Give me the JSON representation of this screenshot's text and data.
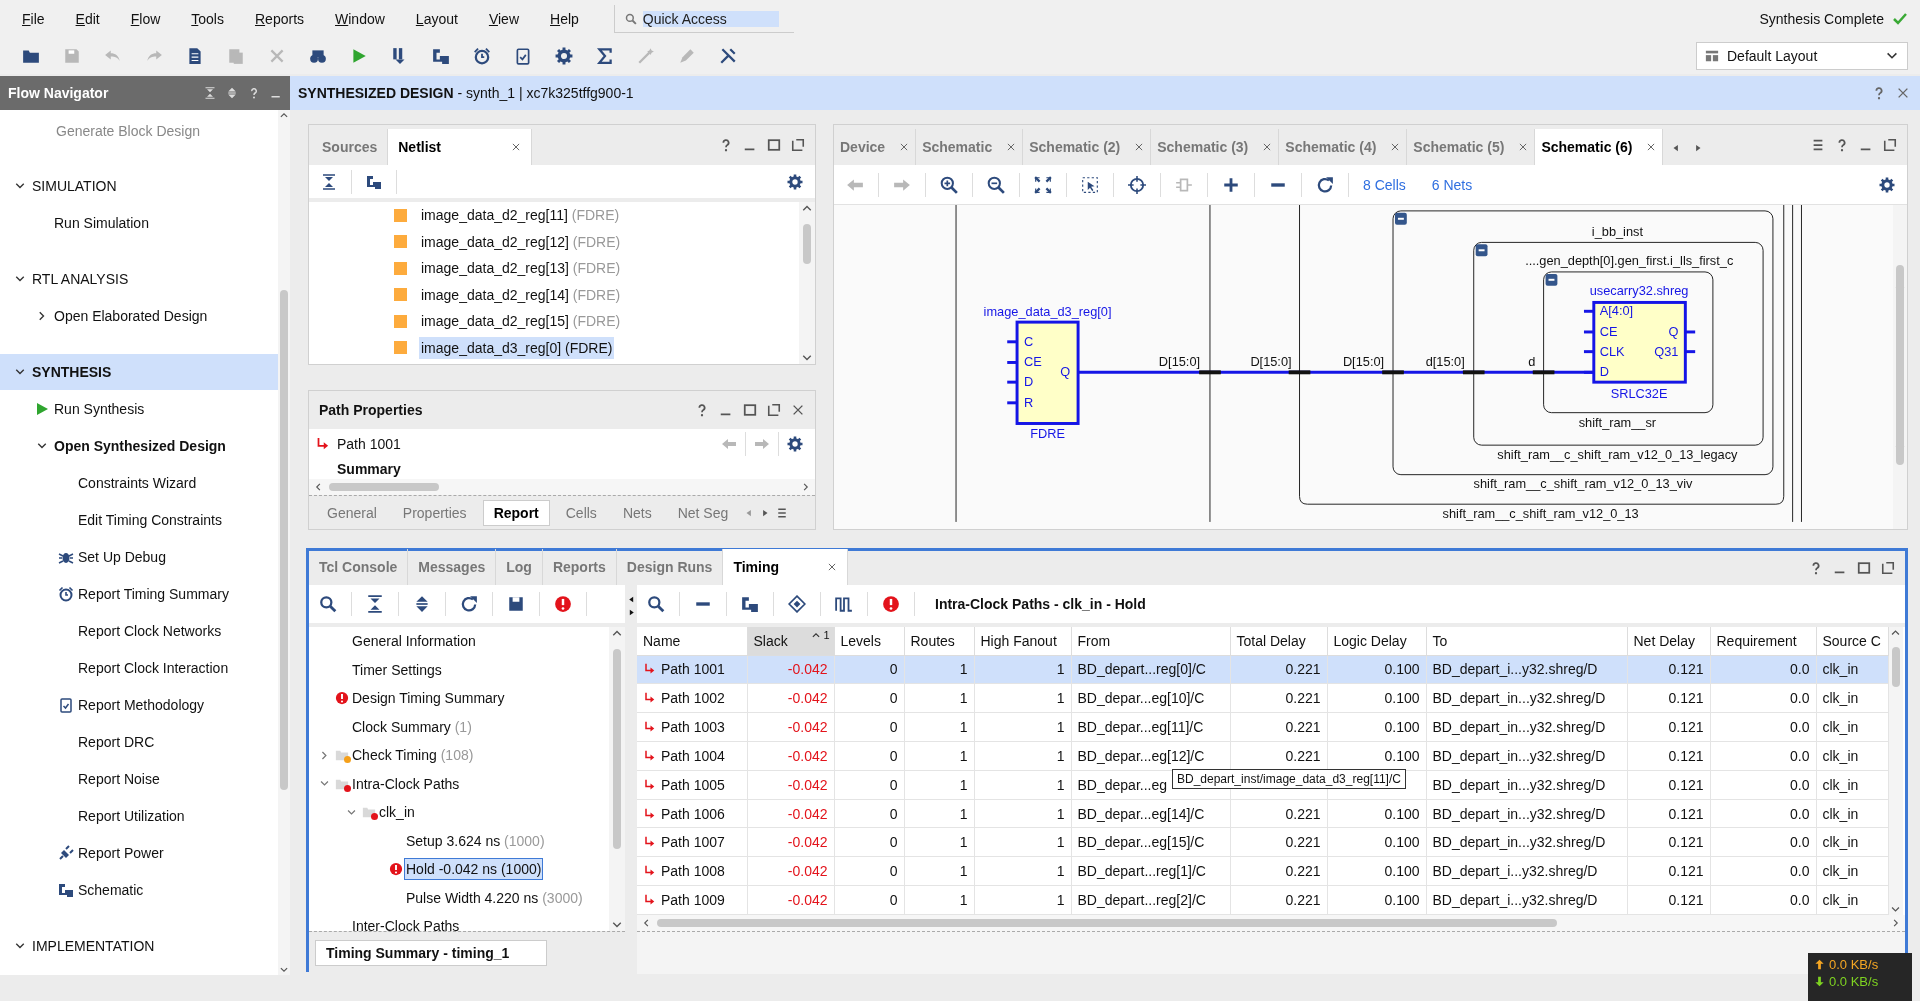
{
  "menu": [
    "File",
    "Edit",
    "Flow",
    "Tools",
    "Reports",
    "Window",
    "Layout",
    "View",
    "Help"
  ],
  "quick_access": {
    "placeholder": "Quick Access"
  },
  "status": "Synthesis Complete",
  "layout_select": {
    "value": "Default Layout"
  },
  "toolbar": [
    {
      "kind": "open",
      "disabled": false
    },
    {
      "kind": "save",
      "disabled": true
    },
    {
      "kind": "undo",
      "disabled": true
    },
    {
      "kind": "redo",
      "disabled": true
    },
    {
      "kind": "copy",
      "disabled": false
    },
    {
      "kind": "paste",
      "disabled": true
    },
    {
      "kind": "delete",
      "disabled": true
    },
    {
      "kind": "binoculars",
      "disabled": false
    },
    {
      "kind": "run",
      "disabled": false
    },
    {
      "kind": "program",
      "disabled": false
    },
    {
      "kind": "schematic",
      "disabled": false
    },
    {
      "kind": "timer",
      "disabled": false
    },
    {
      "kind": "checklist",
      "disabled": false
    },
    {
      "kind": "settings",
      "disabled": false
    },
    {
      "kind": "sigma",
      "disabled": false
    },
    {
      "kind": "wand",
      "disabled": true
    },
    {
      "kind": "pen",
      "disabled": true
    },
    {
      "kind": "tools",
      "disabled": false
    }
  ],
  "flow_navigator": {
    "title": "Flow Navigator",
    "items": [
      {
        "label": "Generate Block Design",
        "kind": "inactive"
      },
      {
        "label": "SIMULATION",
        "kind": "section",
        "expanded": true,
        "selected": false,
        "children": [
          {
            "label": "Run Simulation",
            "kind": "plain"
          }
        ]
      },
      {
        "label": "RTL ANALYSIS",
        "kind": "section",
        "expanded": true,
        "selected": false,
        "children": [
          {
            "label": "Open Elaborated Design",
            "kind": "group",
            "expanded": false,
            "active": false
          }
        ]
      },
      {
        "label": "SYNTHESIS",
        "kind": "section",
        "expanded": true,
        "selected": true,
        "children": [
          {
            "label": "Run Synthesis",
            "kind": "run"
          },
          {
            "label": "Open Synthesized Design",
            "kind": "group",
            "expanded": true,
            "active": true,
            "children": [
              {
                "label": "Constraints Wizard",
                "kind": "plain"
              },
              {
                "label": "Edit Timing Constraints",
                "kind": "plain"
              },
              {
                "label": "Set Up Debug",
                "kind": "debug"
              },
              {
                "label": "Report Timing Summary",
                "kind": "timing"
              },
              {
                "label": "Report Clock Networks",
                "kind": "plain"
              },
              {
                "label": "Report Clock Interaction",
                "kind": "plain"
              },
              {
                "label": "Report Methodology",
                "kind": "methodology"
              },
              {
                "label": "Report DRC",
                "kind": "plain"
              },
              {
                "label": "Report Noise",
                "kind": "plain"
              },
              {
                "label": "Report Utilization",
                "kind": "plain"
              },
              {
                "label": "Report Power",
                "kind": "power"
              },
              {
                "label": "Schematic",
                "kind": "schematic"
              }
            ]
          }
        ]
      },
      {
        "label": "IMPLEMENTATION",
        "kind": "section",
        "expanded": true,
        "selected": false
      }
    ]
  },
  "design_header": {
    "title": "**SYNTHESIZED DESIGN** - synth_1 | xc7k325tffg900-1"
  },
  "netlist_panel": {
    "tabs": [
      {
        "label": "Sources",
        "selected": false,
        "closable": false
      },
      {
        "label": "Netlist",
        "selected": true,
        "closable": true
      }
    ],
    "rows": [
      {
        "name": "image_data_d2_reg[11]",
        "type": "(FDRE)",
        "selected": false
      },
      {
        "name": "image_data_d2_reg[12]",
        "type": "(FDRE)",
        "selected": false
      },
      {
        "name": "image_data_d2_reg[13]",
        "type": "(FDRE)",
        "selected": false
      },
      {
        "name": "image_data_d2_reg[14]",
        "type": "(FDRE)",
        "selected": false
      },
      {
        "name": "image_data_d2_reg[15]",
        "type": "(FDRE)",
        "selected": false
      },
      {
        "name": "image_data_d3_reg[0]",
        "type": "(FDRE)",
        "selected": true
      }
    ]
  },
  "path_properties": {
    "title": "Path Properties",
    "path": "Path 1001",
    "section": "Summary",
    "tabs": [
      {
        "label": "General",
        "selected": false
      },
      {
        "label": "Properties",
        "selected": false
      },
      {
        "label": "Report",
        "selected": true
      },
      {
        "label": "Cells",
        "selected": false
      },
      {
        "label": "Nets",
        "selected": false
      },
      {
        "label": "Net Seg",
        "selected": false
      }
    ]
  },
  "schematic_panel": {
    "tabs": [
      {
        "label": "Device",
        "selected": false
      },
      {
        "label": "Schematic",
        "selected": false
      },
      {
        "label": "Schematic (2)",
        "selected": false
      },
      {
        "label": "Schematic (3)",
        "selected": false
      },
      {
        "label": "Schematic (4)",
        "selected": false
      },
      {
        "label": "Schematic (5)",
        "selected": false
      },
      {
        "label": "Schematic (6)",
        "selected": true
      }
    ],
    "cells": "8 Cells",
    "nets": "6 Nets",
    "register": {
      "instance": "image_data_d3_reg[0]",
      "type": "FDRE",
      "inputs": [
        "C",
        "CE",
        "D",
        "R"
      ],
      "output": "Q"
    },
    "shift_register": {
      "instance": "usecarry32.shreg",
      "type": "SRLC32E",
      "inputs": [
        "A[4:0]",
        "CE",
        "CLK",
        "D"
      ],
      "outputs": [
        "Q",
        "Q31"
      ]
    },
    "net_labels": [
      "D[15:0]",
      "D[15:0]",
      "D[15:0]",
      "d[15:0]",
      "d"
    ],
    "hierarchy": [
      "i_bb_inst",
      "....gen_depth[0].gen_first.i_lls_first_c",
      "shift_ram__sr",
      "shift_ram__c_shift_ram_v12_0_13_legacy",
      "shift_ram__c_shift_ram_v12_0_13_viv",
      "shift_ram__c_shift_ram_v12_0_13"
    ]
  },
  "bottom_panel": {
    "tabs": [
      {
        "label": "Tcl Console",
        "selected": false,
        "closable": false
      },
      {
        "label": "Messages",
        "selected": false,
        "closable": false
      },
      {
        "label": "Log",
        "selected": false,
        "closable": false
      },
      {
        "label": "Reports",
        "selected": false,
        "closable": false
      },
      {
        "label": "Design Runs",
        "selected": false,
        "closable": false
      },
      {
        "label": "Timing",
        "selected": true,
        "closable": true
      }
    ],
    "tree": [
      {
        "label": "General Information",
        "kind": "item",
        "error": false,
        "selected": false
      },
      {
        "label": "Timer Settings",
        "kind": "item",
        "error": false,
        "selected": false
      },
      {
        "label": "Design Timing Summary",
        "kind": "item",
        "error": true,
        "selected": false
      },
      {
        "label": "Clock Summary",
        "count": "(1)",
        "kind": "item",
        "error": false,
        "selected": false
      },
      {
        "label": "Check Timing",
        "count": "(108)",
        "kind": "folder",
        "color": "#f5a01a",
        "expanded": false,
        "error": false,
        "selected": false
      },
      {
        "label": "Intra-Clock Paths",
        "kind": "folder",
        "color": "#e3131b",
        "expanded": true,
        "error": false,
        "selected": false,
        "children": [
          {
            "label": "clk_in",
            "kind": "folder",
            "color": "#e3131b",
            "expanded": true,
            "error": false,
            "selected": false,
            "children": [
              {
                "label": "Setup 3.624 ns",
                "count": "(1000)",
                "kind": "item",
                "error": false,
                "selected": false
              },
              {
                "label": "Hold -0.042 ns",
                "count": "(1000)",
                "kind": "item",
                "error": true,
                "selected": true
              },
              {
                "label": "Pulse Width 4.220 ns",
                "count": "(3000)",
                "kind": "item",
                "error": false,
                "selected": false
              }
            ]
          }
        ]
      },
      {
        "label": "Inter-Clock Paths",
        "kind": "item",
        "error": false,
        "selected": false
      }
    ],
    "report_tab": "Timing Summary - timing_1",
    "table_title": "Intra-Clock Paths - clk_in - Hold",
    "columns": [
      {
        "label": "Name",
        "sorted": false
      },
      {
        "label": "Slack",
        "sorted": true,
        "sort_order": "1"
      },
      {
        "label": "Levels",
        "sorted": false
      },
      {
        "label": "Routes",
        "sorted": false
      },
      {
        "label": "High Fanout",
        "sorted": false
      },
      {
        "label": "From",
        "sorted": false
      },
      {
        "label": "Total Delay",
        "sorted": false
      },
      {
        "label": "Logic Delay",
        "sorted": false
      },
      {
        "label": "To",
        "sorted": false
      },
      {
        "label": "Net Delay",
        "sorted": false
      },
      {
        "label": "Requirement",
        "sorted": false
      },
      {
        "label": "Source C",
        "sorted": false
      }
    ],
    "rows": [
      {
        "name": "Path 1001",
        "slack": "-0.042",
        "levels": "0",
        "routes": "1",
        "high_fanout": "1",
        "from": "BD_depart...reg[0]/C",
        "total_delay": "0.221",
        "logic_delay": "0.100",
        "to": "BD_depart_i...y32.shreg/D",
        "net_delay": "0.121",
        "requirement": "0.0",
        "column_12": "clk_in",
        "selected": true
      },
      {
        "name": "Path 1002",
        "slack": "-0.042",
        "levels": "0",
        "routes": "1",
        "high_fanout": "1",
        "from": "BD_depar...eg[10]/C",
        "total_delay": "0.221",
        "logic_delay": "0.100",
        "to": "BD_depart_in...y32.shreg/D",
        "net_delay": "0.121",
        "requirement": "0.0",
        "column_12": "clk_in",
        "selected": false
      },
      {
        "name": "Path 1003",
        "slack": "-0.042",
        "levels": "0",
        "routes": "1",
        "high_fanout": "1",
        "from": "BD_depar...eg[11]/C",
        "total_delay": "0.221",
        "logic_delay": "0.100",
        "to": "BD_depart_in...y32.shreg/D",
        "net_delay": "0.121",
        "requirement": "0.0",
        "column_12": "clk_in",
        "selected": false
      },
      {
        "name": "Path 1004",
        "slack": "-0.042",
        "levels": "0",
        "routes": "1",
        "high_fanout": "1",
        "from": "BD_depar...eg[12]/C",
        "total_delay": "0.221",
        "logic_delay": "0.100",
        "to": "BD_depart_in...y32.shreg/D",
        "net_delay": "0.121",
        "requirement": "0.0",
        "column_12": "clk_in",
        "selected": false
      },
      {
        "name": "Path 1005",
        "slack": "-0.042",
        "levels": "0",
        "routes": "1",
        "high_fanout": "1",
        "from": "BD_depar...eg",
        "to": "BD_depart_in...y32.shreg/D",
        "net_delay": "0.121",
        "requirement": "0.0",
        "column_12": "clk_in",
        "selected": false
      },
      {
        "name": "Path 1006",
        "slack": "-0.042",
        "levels": "0",
        "routes": "1",
        "high_fanout": "1",
        "from": "BD_depar...eg[14]/C",
        "total_delay": "0.221",
        "logic_delay": "0.100",
        "to": "BD_depart_in...y32.shreg/D",
        "net_delay": "0.121",
        "requirement": "0.0",
        "column_12": "clk_in",
        "selected": false
      },
      {
        "name": "Path 1007",
        "slack": "-0.042",
        "levels": "0",
        "routes": "1",
        "high_fanout": "1",
        "from": "BD_depar...eg[15]/C",
        "total_delay": "0.221",
        "logic_delay": "0.100",
        "to": "BD_depart_in...y32.shreg/D",
        "net_delay": "0.121",
        "requirement": "0.0",
        "column_12": "clk_in",
        "selected": false
      },
      {
        "name": "Path 1008",
        "slack": "-0.042",
        "levels": "0",
        "routes": "1",
        "high_fanout": "1",
        "from": "BD_depart...reg[1]/C",
        "total_delay": "0.221",
        "logic_delay": "0.100",
        "to": "BD_depart_i...y32.shreg/D",
        "net_delay": "0.121",
        "requirement": "0.0",
        "column_12": "clk_in",
        "selected": false
      },
      {
        "name": "Path 1009",
        "slack": "-0.042",
        "levels": "0",
        "routes": "1",
        "high_fanout": "1",
        "from": "BD_depart...reg[2]/C",
        "total_delay": "0.221",
        "logic_delay": "0.100",
        "to": "BD_depart_i...y32.shreg/D",
        "net_delay": "0.121",
        "requirement": "0.0",
        "column_12": "clk_in",
        "selected": false
      }
    ],
    "tooltip": "BD_depart_inst/image_data_d3_reg[11]/C"
  },
  "net_speed": {
    "upload": "0.0 KB/s",
    "download": "0.0 KB/s"
  }
}
